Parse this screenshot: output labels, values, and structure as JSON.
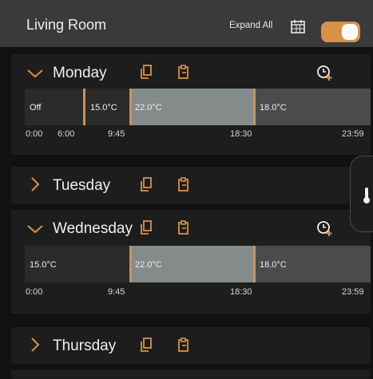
{
  "header": {
    "title": "Living Room",
    "expand_all_label": "Expand All",
    "calendar_icon": "calendar-icon",
    "toggle_state": "on",
    "toggle_color": "#d9914a"
  },
  "days": {
    "monday": {
      "name": "Monday",
      "expanded": true,
      "segments": [
        {
          "label": "Off",
          "start": "0:00",
          "end": "6:00"
        },
        {
          "label": "15.0°C",
          "start": "6:00",
          "end": "9:45"
        },
        {
          "label": "22.0°C",
          "start": "9:45",
          "end": "18:30"
        },
        {
          "label": "18.0°C",
          "start": "18:30",
          "end": "23:59"
        }
      ],
      "times": [
        "0:00",
        "6:00",
        "9:45",
        "18:30",
        "23:59"
      ]
    },
    "tuesday": {
      "name": "Tuesday",
      "expanded": false
    },
    "wednesday": {
      "name": "Wednesday",
      "expanded": true,
      "segments": [
        {
          "label": "15.0°C",
          "start": "0:00",
          "end": "9:45"
        },
        {
          "label": "22.0°C",
          "start": "9:45",
          "end": "18:30"
        },
        {
          "label": "18.0°C",
          "start": "18:30",
          "end": "23:59"
        }
      ],
      "times": [
        "0:00",
        "9:45",
        "18:30",
        "23:59"
      ]
    },
    "thursday": {
      "name": "Thursday",
      "expanded": false
    }
  },
  "colors": {
    "accent": "#c89458",
    "comfort_segment": "#858a8b",
    "eco_segment": "#4b4b4b",
    "off_segment": "#2a2a2a"
  },
  "icons": {
    "copy": "copy-icon",
    "paste": "paste-icon",
    "add_time": "add-time-icon",
    "thermometer": "thermometer-icon"
  }
}
